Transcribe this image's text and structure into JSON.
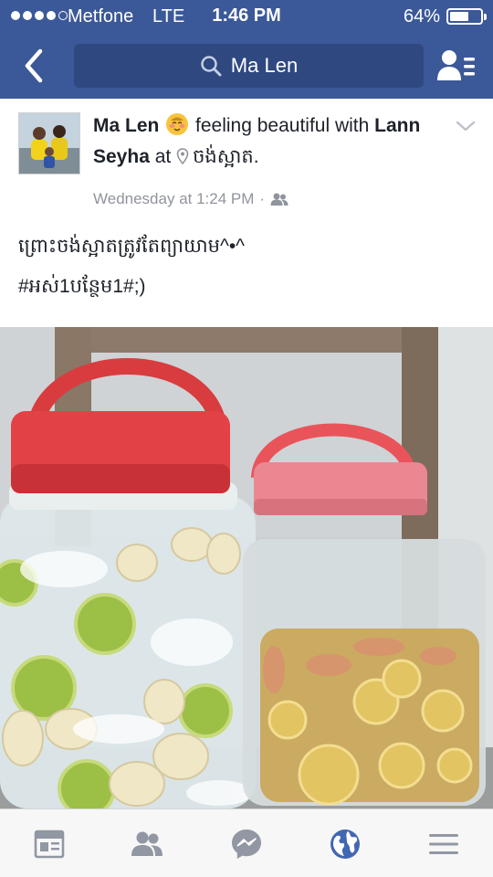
{
  "status_bar": {
    "carrier": "Metfone",
    "network": "LTE",
    "time": "1:46 PM",
    "battery_text": "64%",
    "battery_level": 0.64
  },
  "header": {
    "search_text": "Ma Len",
    "back_icon": "back-chevron-icon",
    "search_icon": "search-icon",
    "friends_icon": "friend-requests-icon"
  },
  "post": {
    "author": "Ma Len",
    "feeling_emoji": "blushing-face-emoji",
    "feeling": "feeling beautiful with",
    "tagged": "Lann Seyha",
    "at_word": "at",
    "place": "ចង់ស្អាត.",
    "timestamp": "Wednesday at 1:24 PM",
    "dot_separator": "·",
    "audience_icon": "friends-audience-icon",
    "text_line1": "ព្រោះចង់ស្អាតត្រូវតែព្យាយាម^•^",
    "text_line2": "#អស់1បន្ថែម1#;)"
  },
  "tabbar": {
    "items": [
      "news-feed-icon",
      "friends-icon",
      "messenger-icon",
      "globe-notifications-icon",
      "more-menu-icon"
    ]
  },
  "colors": {
    "header_blue": "#3b5998",
    "search_bg": "#2f4880",
    "active_tab": "#4267b2",
    "inactive_tab": "#9197a3"
  }
}
